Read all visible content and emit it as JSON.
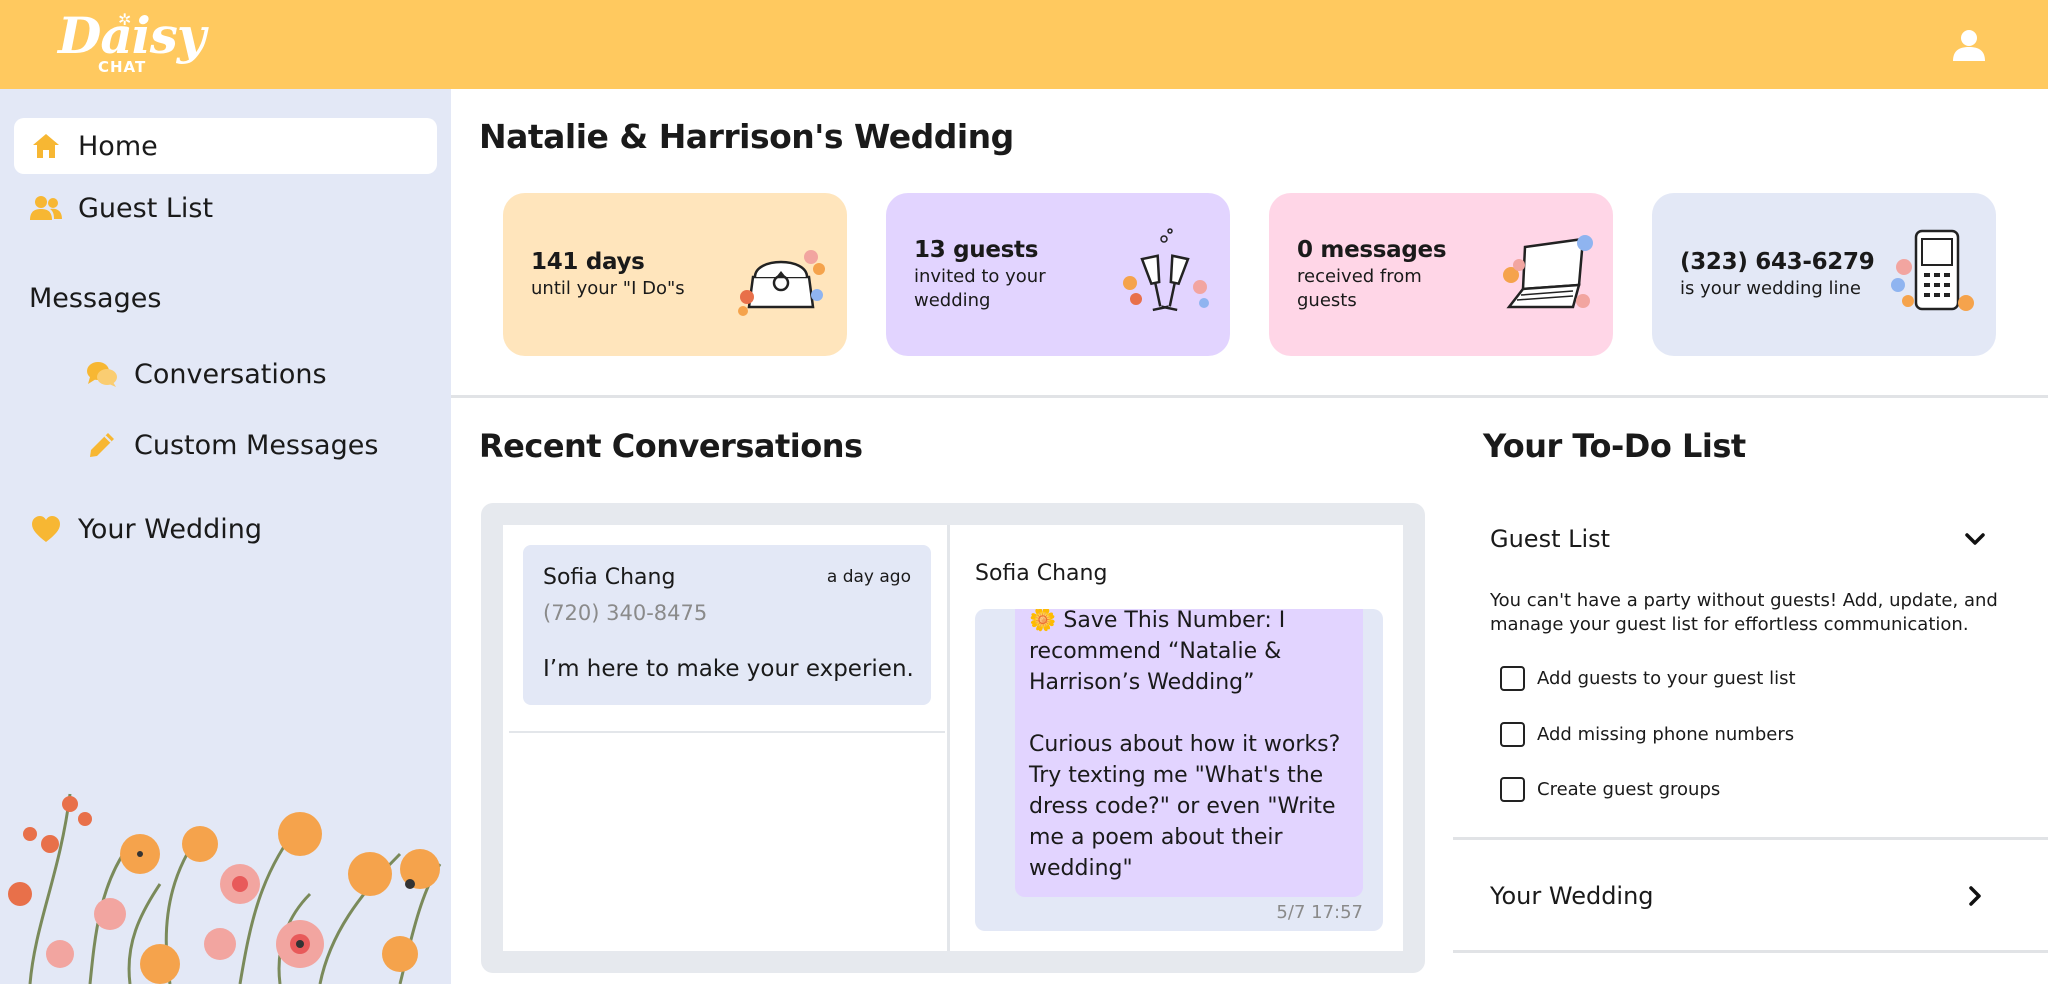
{
  "header": {
    "logo_main": "Daisy",
    "logo_sub": "CHAT"
  },
  "sidebar": {
    "home": "Home",
    "guest_list": "Guest List",
    "messages_section": "Messages",
    "conversations": "Conversations",
    "custom_messages": "Custom Messages",
    "your_wedding": "Your Wedding"
  },
  "main": {
    "title": "Natalie & Harrison's Wedding",
    "cards": [
      {
        "title": "141 days",
        "subtitle": "until your \"I Do\"s",
        "icon": "ring-box-icon",
        "color": "#FFE5BC"
      },
      {
        "title": "13 guests",
        "subtitle": "invited to your wedding",
        "icon": "champagne-glasses-icon",
        "color": "#E2D4FF"
      },
      {
        "title": "0 messages",
        "subtitle": "received from guests",
        "icon": "laptop-icon",
        "color": "#FFD6E7"
      },
      {
        "title": "(323) 643-6279",
        "subtitle": "is your wedding line",
        "icon": "phone-icon",
        "color": "#E3E8F6"
      }
    ]
  },
  "recent": {
    "title": "Recent Conversations",
    "conversations": [
      {
        "name": "Sofia Chang",
        "time": "a day ago",
        "phone": "(720) 340-8475",
        "preview": "I’m here to make your experien..."
      }
    ],
    "chat": {
      "name": "Sofia Chang",
      "message": "🌼 Save This Number: I recommend “Natalie & Harrison’s Wedding”\n\nCurious about how it works? Try texting me \"What's the dress code?\" or even \"Write me a poem about their wedding\"",
      "timestamp": "5/7 17:57"
    }
  },
  "todo": {
    "title": "Your To-Do List",
    "guest_list": {
      "heading": "Guest List",
      "description": "You can't have a party without guests! Add, update, and manage your guest list for effortless communication.",
      "items": [
        "Add guests to your guest list",
        "Add missing phone numbers",
        "Create guest groups"
      ]
    },
    "your_wedding": {
      "heading": "Your Wedding"
    }
  },
  "colors": {
    "header": "#FFC95F",
    "sidebar": "#E3E8F6",
    "accent": "#F7B733"
  }
}
